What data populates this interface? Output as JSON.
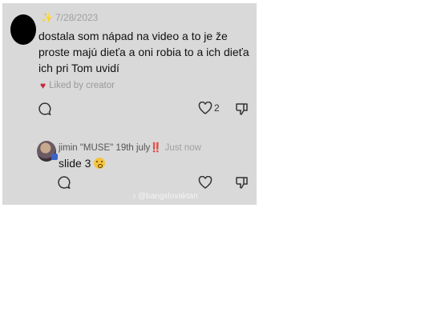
{
  "comment_1": {
    "date": "7/28/2023",
    "text": "dostala som nápad na video a to je že proste majú dieťa a oni robia to a ich dieťa ich pri Tom uvidí",
    "liked_label": "Liked by creator",
    "like_count": "2"
  },
  "reply": {
    "username": "jimin \"MUSE\" 19th july",
    "emphasis": "‼️",
    "time": "Just now",
    "text": "slide 3"
  },
  "watermark": {
    "handle": "@bangslovaktan"
  },
  "colors": {
    "card_bg": "#d9d9d9",
    "heart_red": "#c8283a",
    "muted": "#a0a0a0"
  }
}
